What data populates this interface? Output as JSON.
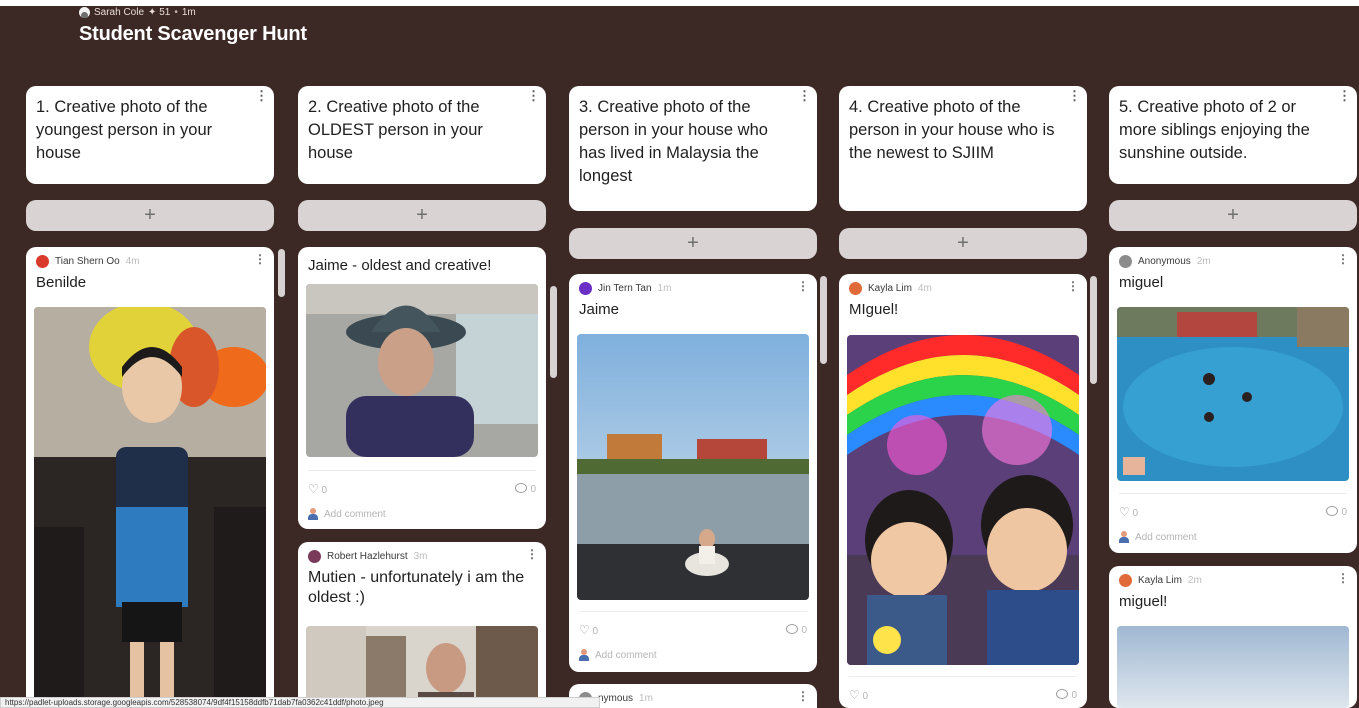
{
  "header": {
    "author": "Sarah Cole",
    "likes": "✦ 51",
    "sep": "•",
    "time": "1m",
    "title": "Student Scavenger Hunt"
  },
  "add_label": "+",
  "menu_glyph": "⋮",
  "columns": [
    {
      "heading": "1. Creative photo of the youngest person in your house",
      "posts": [
        {
          "author": "Tian Shern Oo",
          "time": "4m",
          "title": "Benilde",
          "avatar_color": "#d93a2b"
        }
      ]
    },
    {
      "heading": "2. Creative photo of the OLDEST person in your house",
      "posts": [
        {
          "title": "Jaime - oldest and creative!",
          "likes": "0",
          "comments": "0",
          "add_comment": "Add comment"
        },
        {
          "author": "Robert Hazlehurst",
          "time": "3m",
          "title": "Mutien - unfortunately i am the oldest :)",
          "avatar_color": "#7a3b5a"
        }
      ]
    },
    {
      "heading": "3. Creative photo of the person in your house who has lived in Malaysia the longest",
      "posts": [
        {
          "author": "Jin Tern Tan",
          "time": "1m",
          "title": "Jaime",
          "likes": "0",
          "comments": "0",
          "add_comment": "Add comment",
          "avatar_color": "#6a2fc4"
        },
        {
          "author": "nymous",
          "time": "1m"
        }
      ]
    },
    {
      "heading": "4. Creative photo of the person in your house who is the newest to SJIIM",
      "posts": [
        {
          "author": "Kayla Lim",
          "time": "4m",
          "title": "MIguel!",
          "likes": "0",
          "comments": "0",
          "avatar_color": "#e06a3a"
        }
      ]
    },
    {
      "heading": "5. Creative photo of 2 or more siblings enjoying the sunshine outside.",
      "posts": [
        {
          "author": "Anonymous",
          "time": "2m",
          "title": "miguel",
          "likes": "0",
          "comments": "0",
          "add_comment": "Add comment",
          "avatar_color": "#8c8c8c"
        },
        {
          "author": "Kayla Lim",
          "time": "2m",
          "title": "miguel!",
          "avatar_color": "#e06a3a"
        }
      ]
    }
  ],
  "status_url": "https://padlet-uploads.storage.googleapis.com/528538074/9df4f15158ddfb71dab7fa0362c41ddf/photo.jpeg"
}
